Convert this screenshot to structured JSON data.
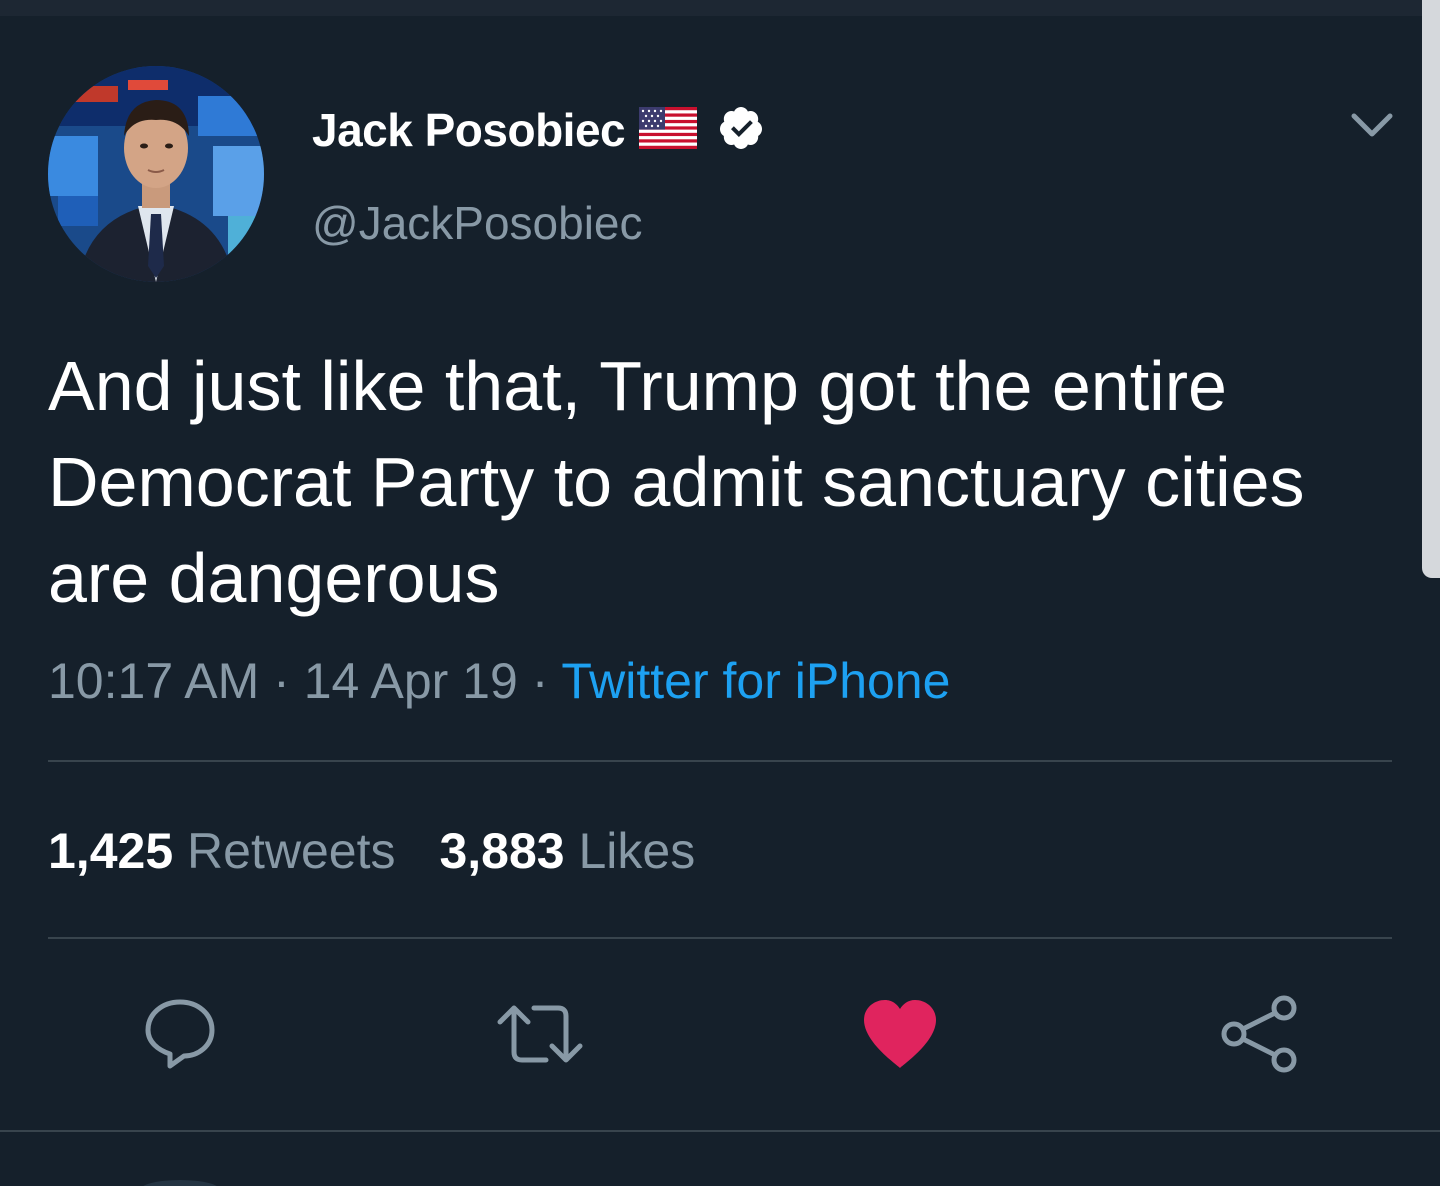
{
  "tweet": {
    "author": {
      "display_name": "Jack Posobiec",
      "handle": "@JackPosobiec",
      "flag_icon": "us-flag-icon",
      "verified_icon": "verified-badge-icon"
    },
    "text": "And just like that, Trump got the entire Democrat Party to admit sanctuary cities are dangerous",
    "time": "10:17 AM",
    "separator": "·",
    "date": "14 Apr 19",
    "source": "Twitter for iPhone",
    "stats": {
      "retweets_count": "1,425",
      "retweets_label": "Retweets",
      "likes_count": "3,883",
      "likes_label": "Likes"
    },
    "actions": {
      "reply_icon": "reply-icon",
      "retweet_icon": "retweet-icon",
      "like_icon": "heart-icon",
      "share_icon": "share-icon",
      "liked": true
    }
  },
  "colors": {
    "background": "#15202b",
    "secondary_text": "#8899a6",
    "link": "#1da1f2",
    "like": "#e0245e",
    "divider": "#38444d"
  }
}
